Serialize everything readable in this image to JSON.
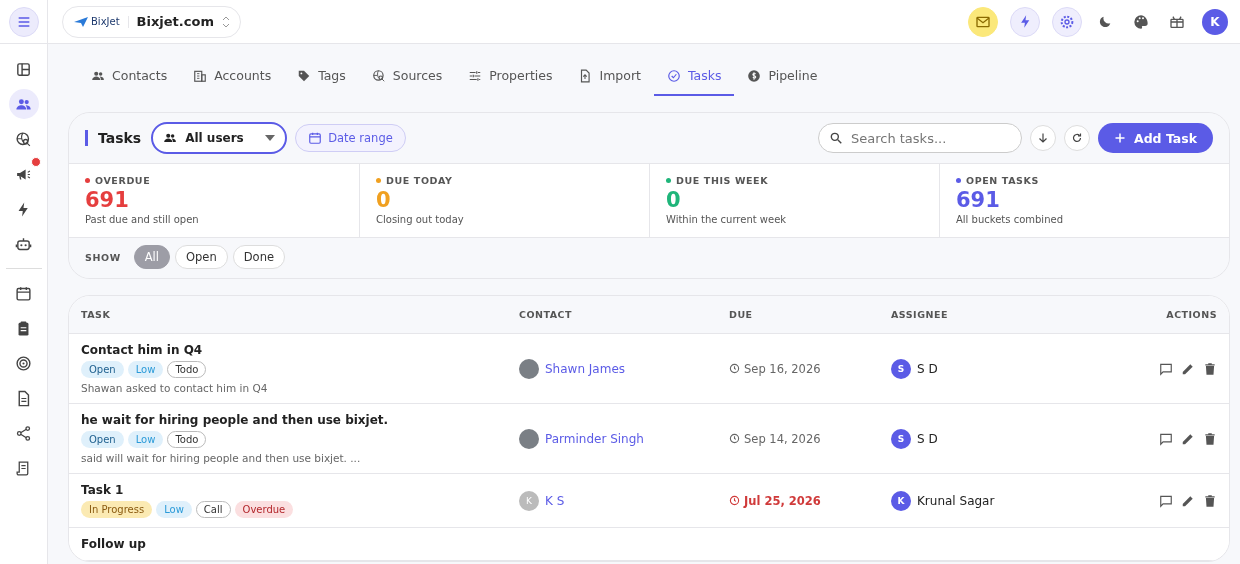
{
  "topbar": {
    "brand_logo": "BixJet",
    "workspace": "Bixjet.com",
    "avatar": "K"
  },
  "sidebar": {
    "items": [
      {
        "selected": false,
        "badge": false
      },
      {
        "selected": true,
        "badge": false
      },
      {
        "selected": false,
        "badge": false
      },
      {
        "selected": false,
        "badge": true
      },
      {
        "selected": false,
        "badge": false
      },
      {
        "selected": false,
        "badge": false
      },
      {
        "selected": false,
        "badge": false
      },
      {
        "selected": false,
        "badge": false
      },
      {
        "selected": false,
        "badge": false
      },
      {
        "selected": false,
        "badge": false
      },
      {
        "selected": false,
        "badge": false
      },
      {
        "selected": false,
        "badge": false
      }
    ]
  },
  "tabs": [
    {
      "label": "Contacts",
      "selected": false
    },
    {
      "label": "Accounts",
      "selected": false
    },
    {
      "label": "Tags",
      "selected": false
    },
    {
      "label": "Sources",
      "selected": false
    },
    {
      "label": "Properties",
      "selected": false
    },
    {
      "label": "Import",
      "selected": false
    },
    {
      "label": "Tasks",
      "selected": true
    },
    {
      "label": "Pipeline",
      "selected": false
    }
  ],
  "toolbar": {
    "title": "Tasks",
    "user_filter": "All users",
    "date_range": "Date range",
    "search": {
      "placeholder": "Search tasks..."
    },
    "add_button": "Add Task"
  },
  "stats": [
    {
      "label": "OVERDUE",
      "value": "691",
      "caption": "Past due and still open",
      "color": "#e53e3e"
    },
    {
      "label": "DUE TODAY",
      "value": "0",
      "caption": "Closing out today",
      "color": "#f0a020"
    },
    {
      "label": "DUE THIS WEEK",
      "value": "0",
      "caption": "Within the current week",
      "color": "#1fb57a"
    },
    {
      "label": "OPEN TASKS",
      "value": "691",
      "caption": "All buckets combined",
      "color": "#5b5be6"
    }
  ],
  "show_filter": {
    "label": "SHOW",
    "options": [
      {
        "label": "All",
        "selected": true
      },
      {
        "label": "Open",
        "selected": false
      },
      {
        "label": "Done",
        "selected": false
      }
    ]
  },
  "table": {
    "columns": [
      "TASK",
      "CONTACT",
      "DUE",
      "ASSIGNEE",
      "ACTIONS"
    ],
    "rows": [
      {
        "title": "Contact him in Q4",
        "tags": [
          {
            "label": "Open",
            "kind": "status"
          },
          {
            "label": "Low",
            "kind": "priority"
          },
          {
            "label": "Todo",
            "kind": "type"
          }
        ],
        "note": "Shawan asked to contact him in Q4",
        "contact": {
          "name": "Shawn James",
          "kind": "photo"
        },
        "due": "Sep 16, 2026",
        "overdue": false,
        "assignee": {
          "initial": "S",
          "name": "S D"
        }
      },
      {
        "title": "he wait for hiring people and then use bixjet.",
        "tags": [
          {
            "label": "Open",
            "kind": "status"
          },
          {
            "label": "Low",
            "kind": "priority"
          },
          {
            "label": "Todo",
            "kind": "type"
          }
        ],
        "note": "said will wait for hiring people and then use bixjet. ...",
        "contact": {
          "name": "Parminder Singh",
          "kind": "photo"
        },
        "due": "Sep 14, 2026",
        "overdue": false,
        "assignee": {
          "initial": "S",
          "name": "S D"
        }
      },
      {
        "title": "Task 1",
        "tags": [
          {
            "label": "In Progress",
            "kind": "progress"
          },
          {
            "label": "Low",
            "kind": "priority"
          },
          {
            "label": "Call",
            "kind": "type"
          },
          {
            "label": "Overdue",
            "kind": "overdue"
          }
        ],
        "contact": {
          "name": "K S",
          "kind": "initials",
          "initial": "K"
        },
        "due": "Jul 25, 2026",
        "overdue": true,
        "assignee": {
          "initial": "K",
          "name": "Krunal Sagar"
        }
      },
      {
        "title": "Follow up",
        "tags": []
      }
    ]
  }
}
